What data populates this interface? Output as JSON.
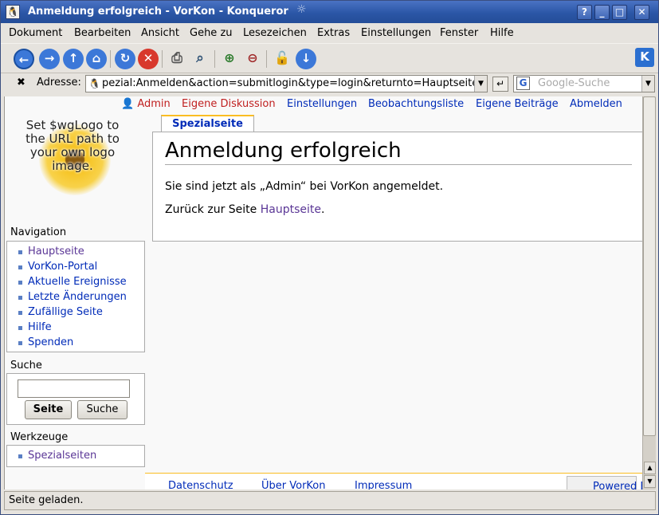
{
  "window": {
    "title": "Anmeldung erfolgreich - VorKon - Konqueror"
  },
  "menubar": {
    "items": [
      "Dokument",
      "Bearbeiten",
      "Ansicht",
      "Gehe zu",
      "Lesezeichen",
      "Extras",
      "Einstellungen",
      "Fenster",
      "Hilfe"
    ]
  },
  "toolbar": {
    "icons": [
      "back-icon",
      "forward-icon",
      "up-icon",
      "home-icon",
      "reload-icon",
      "stop-icon",
      "print-icon",
      "find-icon",
      "zoom-in-icon",
      "zoom-out-icon",
      "security-lock-icon",
      "download-icon"
    ]
  },
  "address": {
    "label": "Adresse:",
    "url": "pezial:Anmelden&action=submitlogin&type=login&returnto=Hauptseite"
  },
  "search": {
    "placeholder": "Google-Suche"
  },
  "page": {
    "personal_links": [
      "Admin",
      "Eigene Diskussion",
      "Einstellungen",
      "Beobachtungsliste",
      "Eigene Beiträge",
      "Abmelden"
    ],
    "tab": "Spezialseite",
    "heading": "Anmeldung erfolgreich",
    "message": "Sie sind jetzt als „Admin“ bei VorKon angemeldet.",
    "back_prefix": "Zurück zur Seite ",
    "back_link": "Hauptseite",
    "back_suffix": ".",
    "logo_text": "Set $wgLogo to the URL path to your own logo image.",
    "navigation": {
      "title": "Navigation",
      "items": [
        "Hauptseite",
        "VorKon-Portal",
        "Aktuelle Ereignisse",
        "Letzte Änderungen",
        "Zufällige Seite",
        "Hilfe",
        "Spenden"
      ]
    },
    "search_box": {
      "title": "Suche",
      "go": "Seite",
      "search": "Suche"
    },
    "toolbox": {
      "title": "Werkzeuge",
      "items": [
        "Spezialseiten"
      ]
    },
    "footer": {
      "links": [
        "Datenschutz",
        "Über VorKon",
        "Impressum"
      ],
      "powered": "Powered By"
    }
  },
  "status": "Seite geladen."
}
